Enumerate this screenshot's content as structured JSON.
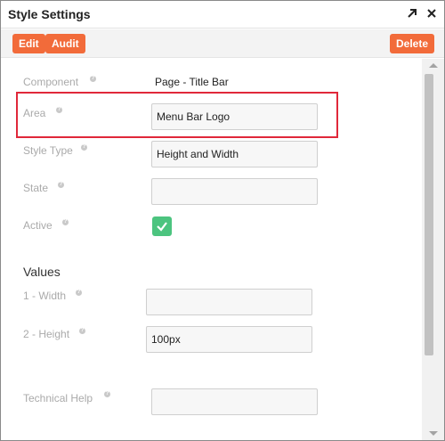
{
  "window": {
    "title": "Style Settings",
    "expand_icon": "expand-arrow-icon",
    "close_icon": "close-icon"
  },
  "toolbar": {
    "edit_label": "Edit",
    "audit_label": "Audit",
    "delete_label": "Delete",
    "button_color": "#f26b3a"
  },
  "form": {
    "component": {
      "label": "Component",
      "value": "Page - Title Bar"
    },
    "area": {
      "label": "Area",
      "value": "Menu Bar Logo"
    },
    "style_type": {
      "label": "Style Type",
      "value": "Height and Width"
    },
    "state": {
      "label": "State",
      "value": ""
    },
    "active": {
      "label": "Active",
      "checked": true,
      "color": "#4cc47f"
    }
  },
  "values_section": {
    "heading": "Values",
    "width": {
      "label": "1 - Width",
      "value": ""
    },
    "height": {
      "label": "2 - Height",
      "value": "100px"
    }
  },
  "technical_help": {
    "label": "Technical Help",
    "value": ""
  },
  "highlight_color": "#e0283a"
}
